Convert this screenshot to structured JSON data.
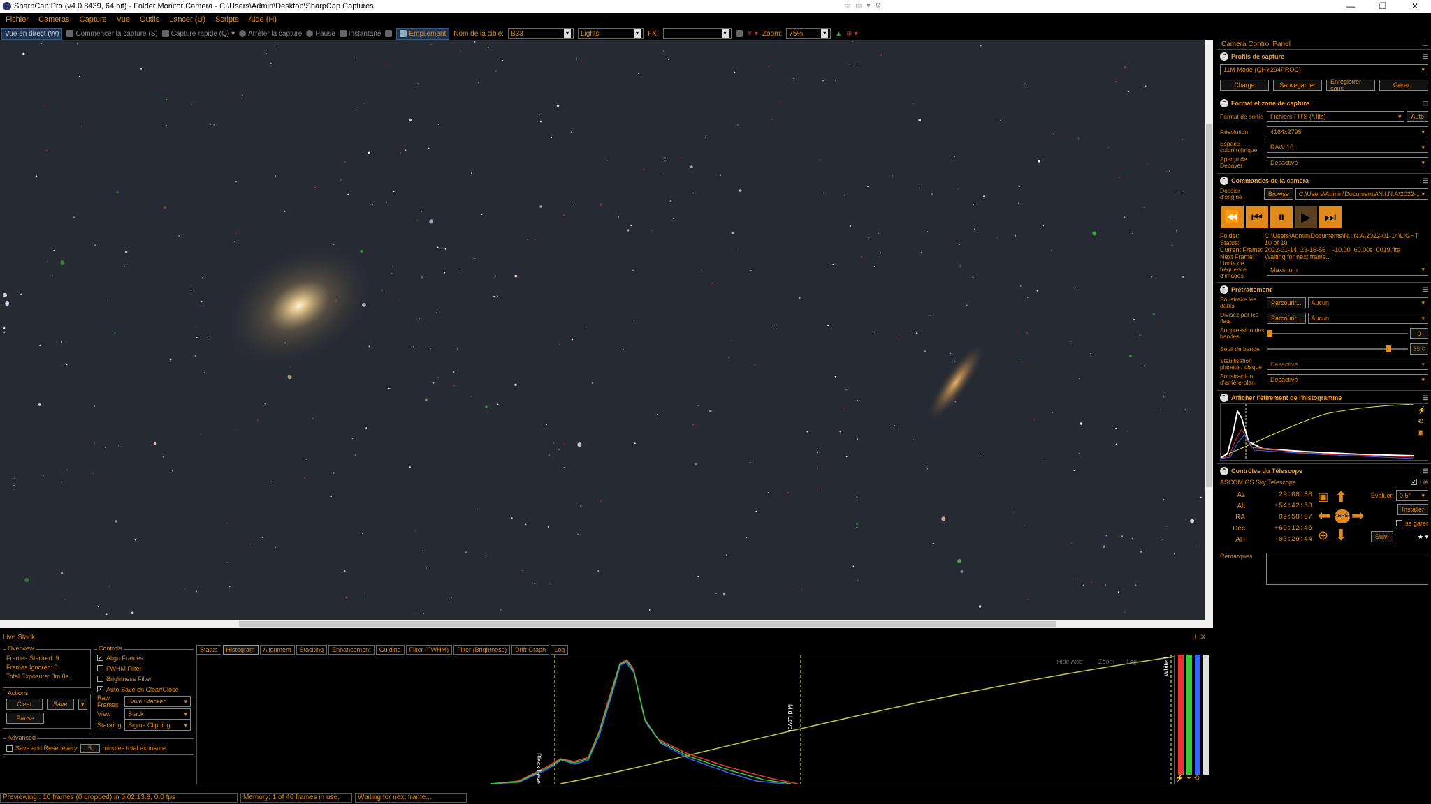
{
  "window": {
    "title": "SharpCap Pro (v4.0.8439, 64 bit) - Folder Monitor Camera - C:\\Users\\Admin\\Desktop\\SharpCap Captures"
  },
  "menu": [
    "Fichier",
    "Cameras",
    "Capture",
    "Vue",
    "Outils",
    "Lancer (U)",
    "Scripts",
    "Aide (H)"
  ],
  "toolbar": {
    "live_view": "Vue en direct (W)",
    "start_capture": "Commencer la capture (S)",
    "quick_capture": "Capture rapide (Q)",
    "stop_capture": "Arrêter la capture",
    "pause": "Pause",
    "snapshot": "Instantané",
    "stacking": "Empilement",
    "target_label": "Nom de la cible:",
    "target_value": "B33",
    "frame_type": "Lights",
    "fx_label": "FX:",
    "fx_value": "",
    "zoom_label": "Zoom:",
    "zoom_value": "75%"
  },
  "panel": {
    "title": "Camera Control Panel",
    "profiles": {
      "header": "Profils de capture",
      "selected": "11M Mode (QHY294PROC)",
      "buttons": [
        "Charge",
        "Sauvegarder",
        "Enregistrer sous",
        "Gérer..."
      ]
    },
    "format": {
      "header": "Format et zone de capture",
      "output_label": "Format de sortie",
      "output_value": "Fichiers FITS (*.fits)",
      "auto": "Auto",
      "resolution_label": "Résolution",
      "resolution_value": "4164x2795",
      "colorspace_label": "Espace colorimétrique",
      "colorspace_value": "RAW 16",
      "debayer_label": "Aperçu de Debayer",
      "debayer_value": "Désactivé"
    },
    "camera": {
      "header": "Commandes de la caméra",
      "folder_label": "Dossier d'origine",
      "browse": "Browse",
      "folder_value": "C:\\Users\\Admin\\Documents\\N.I.N.A\\2022-...",
      "info": [
        {
          "k": "Folder:",
          "v": "C:\\Users\\Admin\\Documents\\N.I.N.A\\2022-01-14\\LIGHT"
        },
        {
          "k": "Status:",
          "v": "10 of 10"
        },
        {
          "k": "Current Frame:",
          "v": "2022-01-14_23-16-56__-10.00_60.00s_0019.fits"
        },
        {
          "k": "Next Frame:",
          "v": "Waiting for next frame..."
        }
      ],
      "rate_label": "Limite de fréquence d'images",
      "rate_value": "Maximum"
    },
    "preproc": {
      "header": "Prétraitement",
      "darks_label": "Soustraire les darks",
      "darks_browse": "Parcourir...",
      "darks_value": "Aucun",
      "flats_label": "Divisez par les flats",
      "flats_browse": "Parcourir...",
      "flats_value": "Aucun",
      "banding_label": "Suppression des bandes",
      "banding_value": "0",
      "banding_fraction": 0.0,
      "threshold_label": "Seuil de bande",
      "threshold_value": "35.0",
      "threshold_fraction": 0.88,
      "stab_label": "Stabilisation planète / disque",
      "stab_value": "Désactivé",
      "bg_label": "Soustraction d'arrière-plan",
      "bg_value": "Désactivé"
    },
    "histstretch": {
      "header": "Afficher l'étirement de l'histogramme"
    },
    "telescope": {
      "header": "Contrôles du Télescope",
      "name": "ASCOM GS Sky Telescope",
      "linked": "Lié",
      "coords": [
        {
          "k": "Az",
          "v": "29:08:38"
        },
        {
          "k": "Alt",
          "v": "+54:42:53"
        },
        {
          "k": "RA",
          "v": "09:58:07"
        },
        {
          "k": "Déc",
          "v": "+69:12:46"
        },
        {
          "k": "AH",
          "v": "-03:29:44"
        }
      ],
      "rate_label": "Évaluer:",
      "rate_value": "0.5°",
      "install": "Installer",
      "park": "se garer",
      "follow": "Suivi",
      "stop": "ARRÊT",
      "remarks_label": "Remarques"
    }
  },
  "livestack": {
    "title": "Live Stack",
    "overview": {
      "title": "Overview",
      "stacked_label": "Frames Stacked:",
      "stacked": "9",
      "ignored_label": "Frames Ignored:",
      "ignored": "0",
      "exposure_label": "Total Exposure:",
      "exposure": "3m 0s"
    },
    "controls": {
      "title": "Controls",
      "align": "Align Frames",
      "fwhm": "FWHM Filter",
      "brightness": "Brightness Filter",
      "autosave": "Auto Save on Clear/Close",
      "raw_label": "Raw Frames",
      "raw_value": "Save Stacked",
      "view_label": "View",
      "view_value": "Stack",
      "stacking_label": "Stacking",
      "stacking_value": "Sigma Clipping"
    },
    "actions": {
      "title": "Actions",
      "clear": "Clear",
      "save": "Save",
      "pause": "Pause"
    },
    "advanced": {
      "title": "Advanced",
      "save_reset": "Save and Reset every",
      "minutes_value": "5",
      "minutes_label": "minutes total exposure"
    },
    "tabs": [
      "Status",
      "Histogram",
      "Alignment",
      "Stacking",
      "Enhancement",
      "Guiding",
      "Filter (FWHM)",
      "Filter (Brightness)",
      "Drift Graph",
      "Log"
    ],
    "hist": {
      "black": "Black Level",
      "mid": "Mid Level",
      "white": "White Level",
      "hide_axis": "Hide Axis",
      "zoom": "Zoom",
      "log": "Log"
    }
  },
  "status": {
    "preview": "Previewing : 10 frames (0 dropped) in 0:02:13.8, 0.0 fps",
    "memory": "Memory: 1 of 46 frames in use.",
    "waiting": "Waiting for next frame..."
  },
  "colors": {
    "accent": "#e08a1e",
    "sky": "#262a33"
  }
}
